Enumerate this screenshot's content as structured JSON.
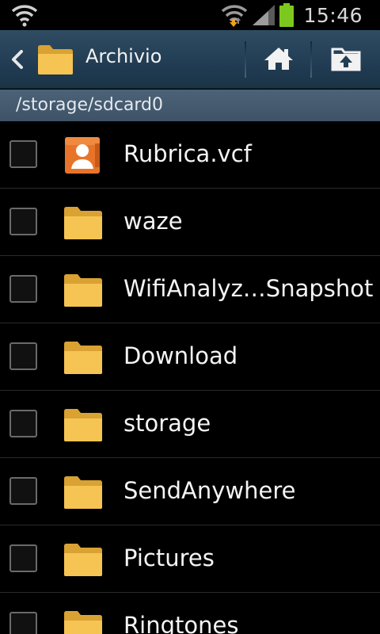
{
  "status_bar": {
    "time": "15:46",
    "icons": [
      "wifi-icon",
      "wifi-transfer-icon",
      "signal-icon",
      "battery-icon"
    ],
    "battery_color": "#7dc81e"
  },
  "action_bar": {
    "title": "Archivio",
    "back_icon": "chevron-left-icon",
    "app_icon": "folder-icon",
    "home_icon": "home-icon",
    "up_icon": "folder-up-icon"
  },
  "path": "/storage/sdcard0",
  "files": [
    {
      "name": "Rubrica.vcf",
      "icon": "contact-card-icon"
    },
    {
      "name": "waze",
      "icon": "folder-icon"
    },
    {
      "name": "WifiAnalyz…Snapshot",
      "icon": "folder-icon"
    },
    {
      "name": "Download",
      "icon": "folder-icon"
    },
    {
      "name": "storage",
      "icon": "folder-icon"
    },
    {
      "name": "SendAnywhere",
      "icon": "folder-icon"
    },
    {
      "name": "Pictures",
      "icon": "folder-icon"
    },
    {
      "name": "Ringtones",
      "icon": "folder-icon"
    }
  ],
  "colors": {
    "action_bar": "#223e54",
    "path_bar": "#455b70",
    "folder": "#f5c04a",
    "contact_icon": "#e8742a"
  }
}
